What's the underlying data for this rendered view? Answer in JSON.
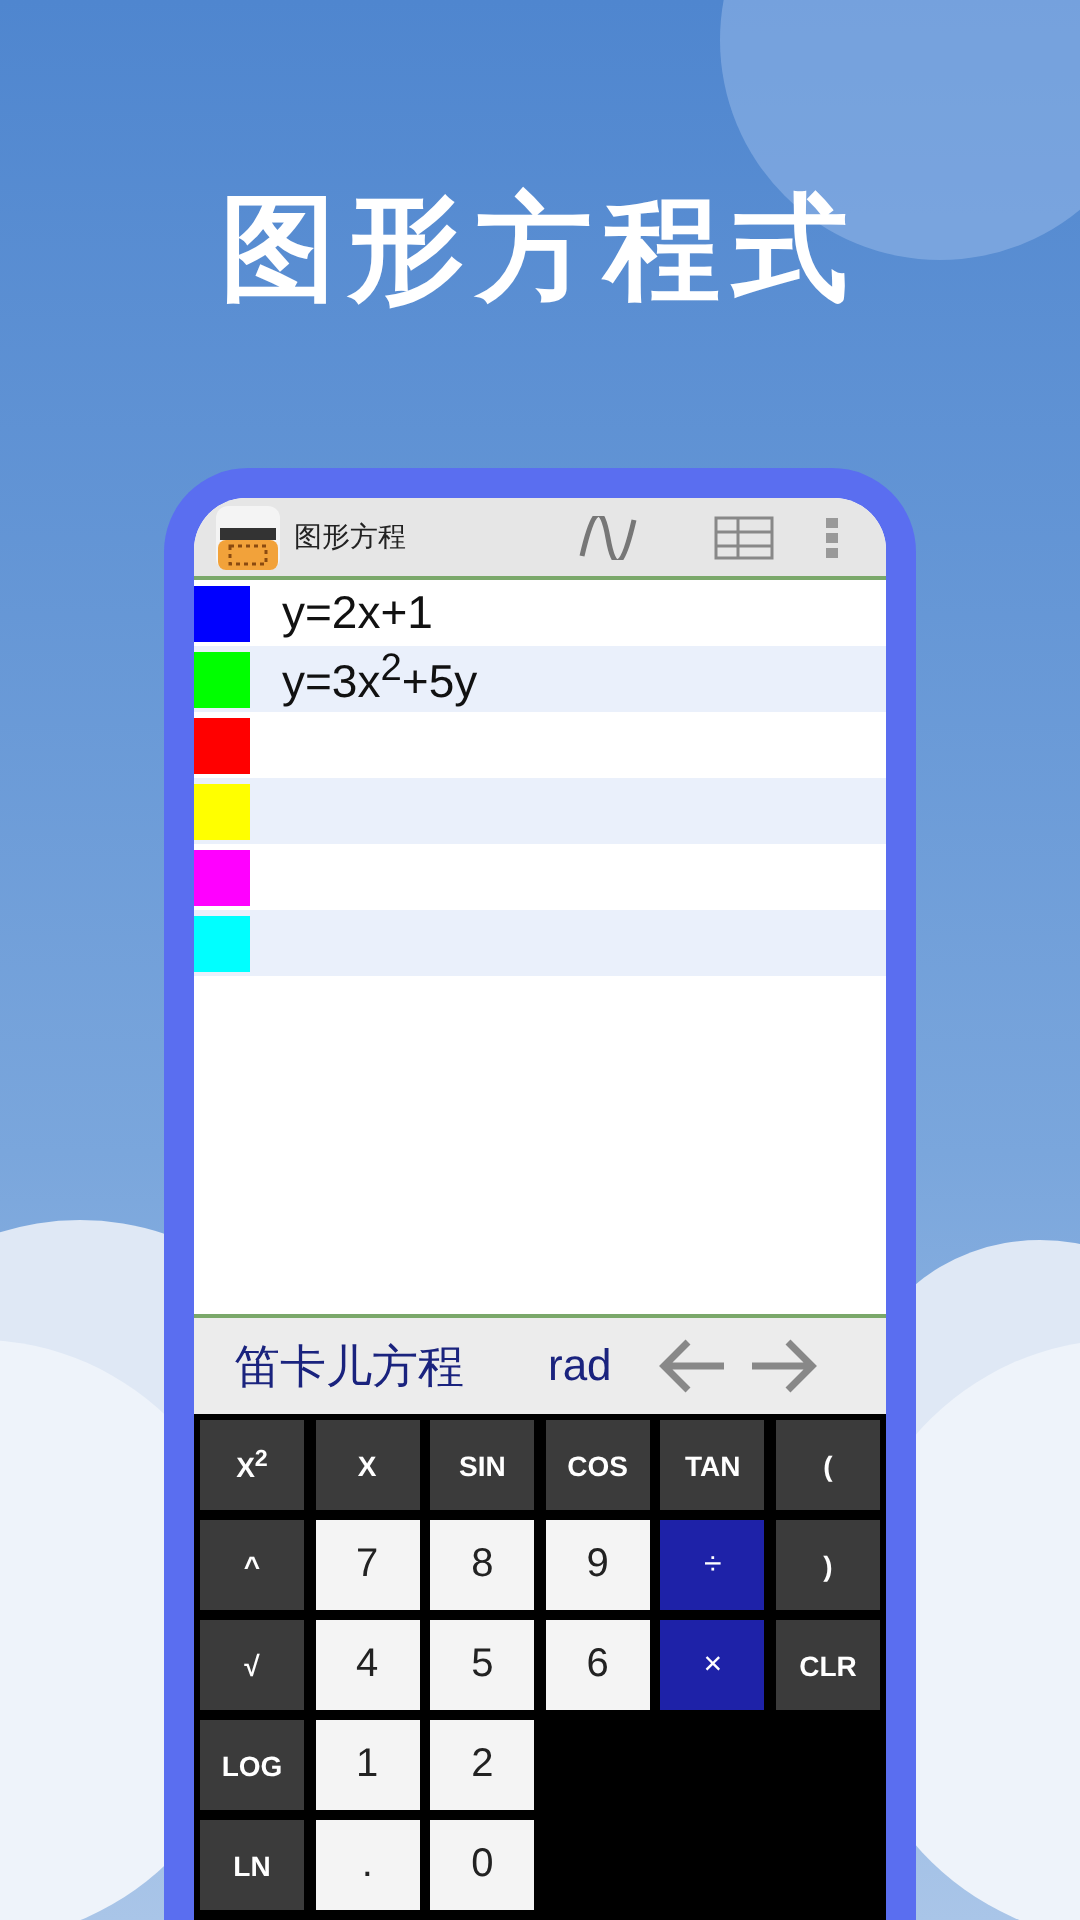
{
  "title": "图形方程式",
  "app": {
    "name": "图形方程"
  },
  "equations": [
    {
      "color": "#0000ff",
      "text": "y=2x+1"
    },
    {
      "color": "#00ff00",
      "text": "y=3x$^{2}$+5y"
    },
    {
      "color": "#ff0000"
    },
    {
      "color": "#ffff00"
    },
    {
      "color": "#ff00ff"
    },
    {
      "color": "#00ffff"
    }
  ],
  "mode": {
    "label": "笛卡儿方程",
    "angle": "rad"
  },
  "keys": [
    [
      {
        "label": "X$^{2}$",
        "kind": "function"
      },
      {
        "label": "X",
        "kind": "function"
      },
      {
        "label": "SIN",
        "kind": "function"
      },
      {
        "label": "COS",
        "kind": "function"
      },
      {
        "label": "TAN",
        "kind": "function"
      },
      {
        "label": "(",
        "kind": "function"
      }
    ],
    [
      {
        "label": "^",
        "kind": "function"
      },
      {
        "label": "7",
        "kind": "digit"
      },
      {
        "label": "8",
        "kind": "digit"
      },
      {
        "label": "9",
        "kind": "digit"
      },
      {
        "label": "÷",
        "kind": "operator"
      },
      {
        "label": ")",
        "kind": "function"
      }
    ],
    [
      {
        "label": "√",
        "kind": "function"
      },
      {
        "label": "4",
        "kind": "digit"
      },
      {
        "label": "5",
        "kind": "digit"
      },
      {
        "label": "6",
        "kind": "digit"
      },
      {
        "label": "×",
        "kind": "operator"
      },
      {
        "label": "CLR",
        "kind": "function"
      }
    ],
    [
      {
        "label": "LOG",
        "kind": "function"
      },
      {
        "label": "1",
        "kind": "digit"
      },
      {
        "label": "2",
        "kind": "digit"
      }
    ],
    [
      {
        "label": "LN",
        "kind": "function"
      },
      {
        "label": ".",
        "kind": "digit"
      },
      {
        "label": "0",
        "kind": "digit"
      }
    ]
  ]
}
